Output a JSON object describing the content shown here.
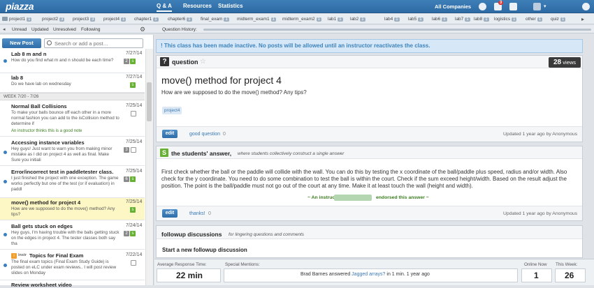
{
  "app": {
    "logo": "piazza"
  },
  "nav": {
    "items": [
      "Q & A",
      "Resources",
      "Statistics"
    ],
    "company": "All Companies",
    "notif_count": "3"
  },
  "folders": [
    {
      "name": "project1",
      "count": "1"
    },
    {
      "name": "project2",
      "count": "3"
    },
    {
      "name": "project3",
      "count": "3"
    },
    {
      "name": "project4",
      "count": "1"
    },
    {
      "name": "chapter1",
      "count": "1"
    },
    {
      "name": "chapter6",
      "count": "1"
    },
    {
      "name": "final_exam",
      "count": "1"
    },
    {
      "name": "midterm_exam1",
      "count": "1"
    },
    {
      "name": "midterm_exam2",
      "count": "1"
    },
    {
      "name": "lab1",
      "count": "1"
    },
    {
      "name": "lab2",
      "count": "1"
    },
    {
      "name": "lab4",
      "count": "1"
    },
    {
      "name": "lab5",
      "count": "1"
    },
    {
      "name": "lab6",
      "count": "1"
    },
    {
      "name": "lab7",
      "count": "1"
    },
    {
      "name": "lab8",
      "count": "1"
    },
    {
      "name": "logistics",
      "count": "1"
    },
    {
      "name": "other",
      "count": "1"
    },
    {
      "name": "quiz",
      "count": "1"
    }
  ],
  "filters": {
    "items": [
      "Unread",
      "Updated",
      "Unresolved",
      "Following"
    ],
    "history_label": "Question History:"
  },
  "sidebar": {
    "new_post": "New Post",
    "search_placeholder": "Search or add a post…",
    "week_header": "WEEK 7/20 - 7/26",
    "posts": [
      {
        "title": "Lab 8 m and n",
        "snippet": "How do you find what m and n should be each time?",
        "date": "7/27/14",
        "b1": "2"
      },
      {
        "title": "lab 8",
        "snippet": "Do we have lab on wednesday",
        "date": "7/27/14"
      },
      {
        "title": "Normal Ball Collisions",
        "snippet": "To make your balls bounce off each other in a more normal fashion you can add to the isCollision method to determine if",
        "date": "7/25/14",
        "instructor": "An instructor thinks this is a good note"
      },
      {
        "title": "Accessing instance variables",
        "snippet": "Hey guys! Just want to warn you from making minor mistake as I did on project 4 as well as final. Make Sure you initiali",
        "date": "7/25/14",
        "b1": "3"
      },
      {
        "title": "Error/incorrect test in paddletester class.",
        "snippet": "I just finished the project with one exception. The game works perfectly but one of the test (or if evaluation) in paddl",
        "date": "7/25/14",
        "b1": "6"
      },
      {
        "title": "move() method for project 4",
        "snippet": "How are we supposed to do the move() method? Any tips?",
        "date": "7/25/14"
      },
      {
        "title": "Ball gets stuck on edges",
        "snippet": "Hey guys, I'm having trouble with the balls getting stuck on the edges in project 4. The tester classes both say tha",
        "date": "7/24/14",
        "b1": "2"
      },
      {
        "title": "Topics for Final Exam",
        "snippet": "The final exam topics (Final Exam Study Guide) is posted on eLC under exam reviews.. I will post review slides on Monday",
        "date": "7/22/14",
        "tag": "instr"
      },
      {
        "title": "Review worksheet video",
        "snippet": "",
        "date": ""
      }
    ]
  },
  "banner": "! This class has been made inactive. No posts will be allowed until an instructor reactivates the class.",
  "question": {
    "label": "question",
    "views_count": "28",
    "views_label": "views",
    "title": "move() method for project 4",
    "body": "How are we supposed to do the move() method? Any tips?",
    "tag": "project4",
    "edit": "edit",
    "good_question": "good question",
    "good_count": "0",
    "updated": "Updated 1 year ago by Anonymous"
  },
  "answer": {
    "label": "the students' answer,",
    "sub": "where students collectively construct a single answer",
    "body": "First check whether the ball or the paddle will collide with the wall. You can do this by testing the x coordinate of the ball/paddle plus speed, radius and/or width. Also check for the y coordinate. You need to do some combination to test the ball is within the court. Check if the sum exceed height/width. Based on the result adjust the position. The point is the ball/paddle must not go out of the court at any time. Make it at least touch the wall (height and width).",
    "endorse_pre": "~ An instructor",
    "endorse_post": "endorsed this answer ~",
    "edit": "edit",
    "thanks": "thanks!",
    "thanks_count": "0",
    "updated": "Updated 1 year ago by Anonymous"
  },
  "followup": {
    "label": "followup discussions",
    "sub": "for lingering questions and comments",
    "start": "Start a new followup discussion"
  },
  "status": {
    "avg_label": "Average Response Time:",
    "avg_value": "22 min",
    "mentions_label": "Special Mentions:",
    "mention_name": "Brad Barnes answered",
    "mention_link": "Jagged arrays?",
    "mention_rest": "in 1 min. 1 year ago",
    "online_label": "Online Now",
    "online_value": "1",
    "week_label": "This Week:",
    "week_value": "26"
  },
  "colors": {
    "brand": "#2c6aa4",
    "accent_green": "#66b033",
    "banner_bg": "#d6e8f7"
  }
}
